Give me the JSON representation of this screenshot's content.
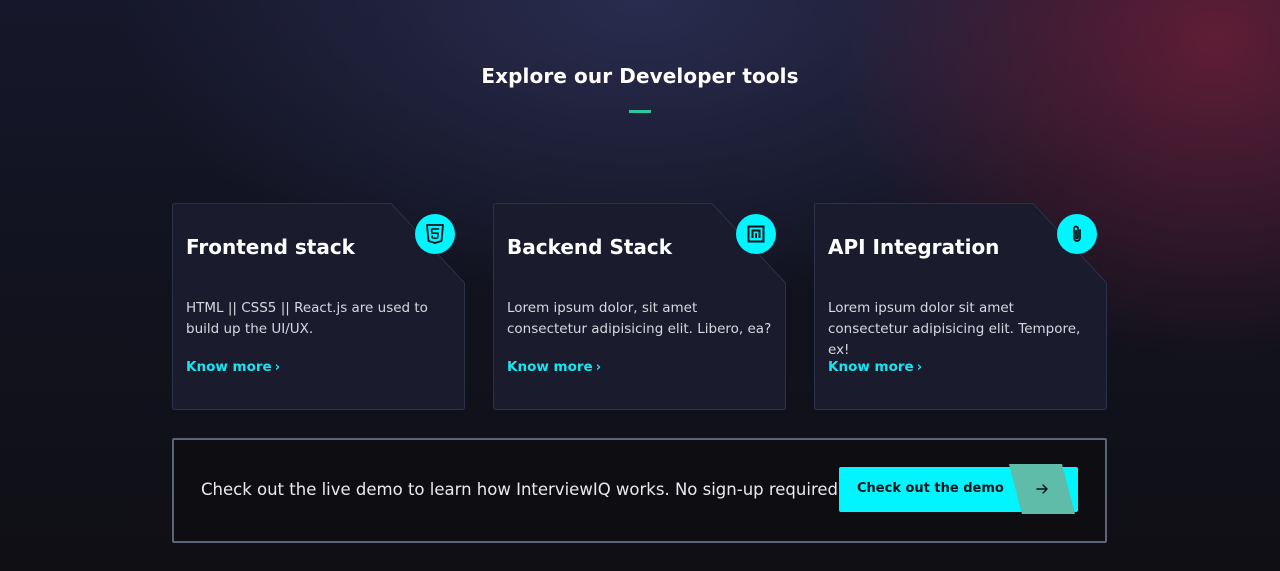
{
  "section": {
    "title": "Explore our Developer tools"
  },
  "cards": [
    {
      "title": "Frontend stack",
      "description": "HTML || CSS5 || React.js are used to build up the UI/UX.",
      "link": "Know more",
      "icon": "html5-icon"
    },
    {
      "title": "Backend Stack",
      "description": "Lorem ipsum dolor, sit amet consectetur adipisicing elit. Libero, ea?",
      "link": "Know more",
      "icon": "nodejs-icon"
    },
    {
      "title": "API Integration",
      "description": "Lorem ipsum dolor sit amet consectetur adipisicing elit. Tempore, ex!",
      "link": "Know more",
      "icon": "paperclip-icon"
    }
  ],
  "demo": {
    "text": "Check out the live demo to learn how InterviewIQ works. No sign-up required!",
    "button_label": "Check out the demo",
    "button_icon": "arrow-right-icon"
  },
  "colors": {
    "accent": "#00f5ff",
    "underline": "#2ec8a0",
    "card_bg": "#1a1c2e",
    "link": "#18e4f0"
  }
}
